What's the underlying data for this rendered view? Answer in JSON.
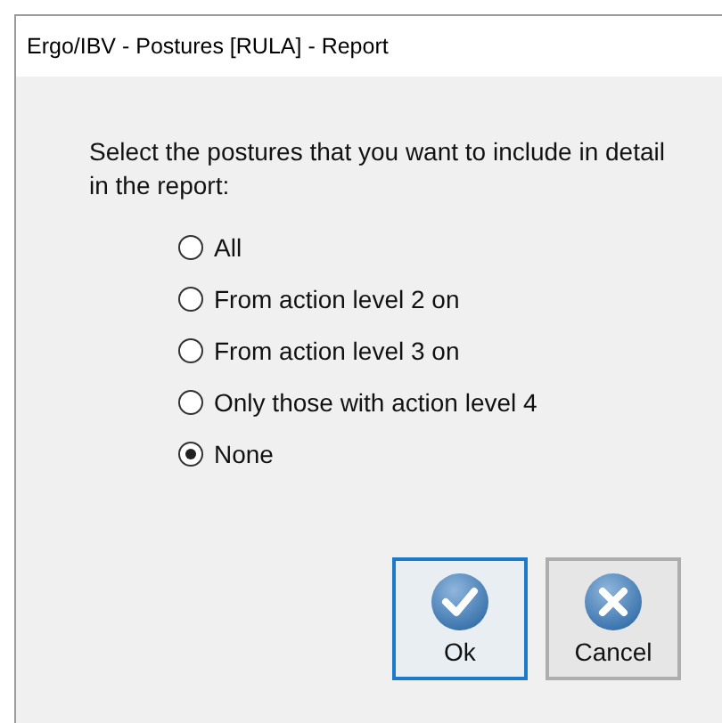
{
  "window": {
    "title": "Ergo/IBV - Postures [RULA] - Report"
  },
  "prompt": "Select the postures that you want to include in detail in the report:",
  "options": [
    {
      "label": "All",
      "selected": false
    },
    {
      "label": "From action level 2 on",
      "selected": false
    },
    {
      "label": "From action level 3 on",
      "selected": false
    },
    {
      "label": "Only those with action level 4",
      "selected": false
    },
    {
      "label": "None",
      "selected": true
    }
  ],
  "buttons": [
    {
      "label": "Ok",
      "kind": "check",
      "focused": true
    },
    {
      "label": "Cancel",
      "kind": "cross",
      "focused": false
    }
  ]
}
